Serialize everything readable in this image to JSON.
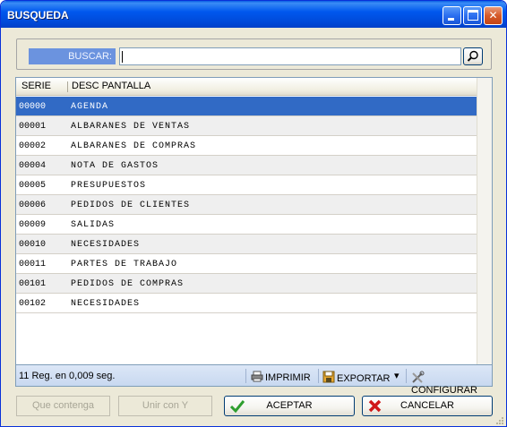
{
  "window": {
    "title": "BUSQUEDA",
    "controls": {
      "minimize": "_",
      "maximize": "□",
      "close": "✕"
    }
  },
  "search": {
    "label": "BUSCAR:",
    "value": "",
    "button_icon": "magnifier-icon"
  },
  "grid": {
    "columns": [
      "SERIE",
      "DESC PANTALLA"
    ],
    "selected_row": 0,
    "rows": [
      {
        "code": "00000",
        "desc": "AGENDA"
      },
      {
        "code": "00001",
        "desc": "ALBARANES DE VENTAS"
      },
      {
        "code": "00002",
        "desc": "ALBARANES DE COMPRAS"
      },
      {
        "code": "00004",
        "desc": "NOTA DE GASTOS"
      },
      {
        "code": "00005",
        "desc": "PRESUPUESTOS"
      },
      {
        "code": "00006",
        "desc": "PEDIDOS DE CLIENTES"
      },
      {
        "code": "00009",
        "desc": "SALIDAS"
      },
      {
        "code": "00010",
        "desc": "NECESIDADES"
      },
      {
        "code": "00011",
        "desc": "PARTES DE TRABAJO"
      },
      {
        "code": "00101",
        "desc": "PEDIDOS DE COMPRAS"
      },
      {
        "code": "00102",
        "desc": "NECESIDADES"
      }
    ]
  },
  "statusbar": {
    "count_text": "11 Reg. en 0,009 seg.",
    "print_label": "IMPRIMIR",
    "export_label": "EXPORTAR",
    "export_arrow": "▾",
    "config_label": "CONFIGURAR"
  },
  "buttons": {
    "contains_label": "Que contenga",
    "join_label": "Unir con Y",
    "accept_label": "ACEPTAR",
    "cancel_label": "CANCELAR"
  },
  "colors": {
    "titlebar": "#0058ee",
    "selection": "#316ac5",
    "search_label_bg": "#6b93df",
    "accept_icon": "#2e9e2e",
    "cancel_icon": "#d01818"
  }
}
